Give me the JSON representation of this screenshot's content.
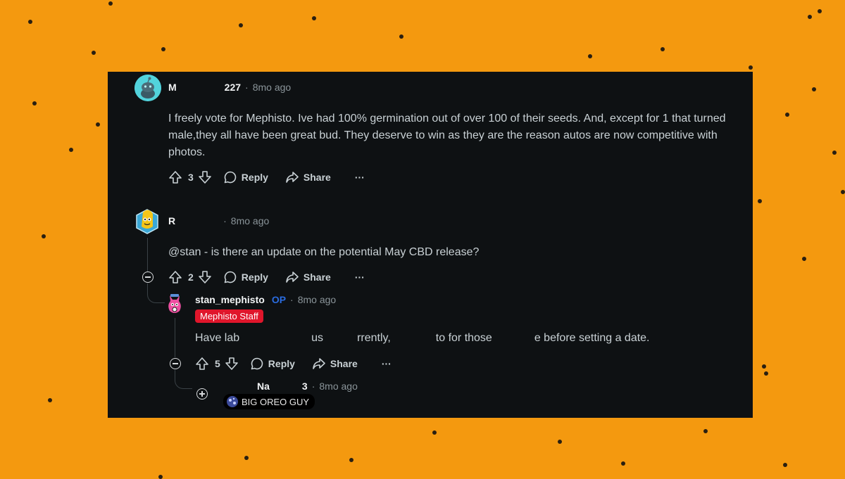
{
  "comments": [
    {
      "author": "M",
      "author_suffix": "227",
      "time": "8mo ago",
      "body": "I freely vote for Mephisto. Ive had 100% germination out of over 100 of their seeds. And, except for 1 that turned male,they all have been great bud. They deserve to win as they are the reason autos are now competitive with photos.",
      "votes": "3",
      "reply_label": "Reply",
      "share_label": "Share",
      "more_label": "···"
    },
    {
      "author": "R",
      "time": "8mo ago",
      "body": "@stan - is there an update on the potential May CBD release?",
      "votes": "2",
      "reply_label": "Reply",
      "share_label": "Share",
      "more_label": "···"
    },
    {
      "author": "stan_mephisto",
      "op_badge": "OP",
      "time": "8mo ago",
      "flair": "Mephisto Staff",
      "body_parts": [
        "Have lab",
        "us",
        "rrently,",
        "to for those",
        "e before setting a date."
      ],
      "votes": "5",
      "reply_label": "Reply",
      "share_label": "Share",
      "more_label": "···"
    },
    {
      "author": "Na",
      "author_suffix": "3",
      "time": "8mo ago",
      "flair": "BIG OREO GUY"
    }
  ],
  "colors": {
    "background": "#f4990f",
    "panel": "#0e1113",
    "staff_flair": "#e0162b",
    "op": "#2a6ce0"
  },
  "icons": [
    "snoo-avatar-icon",
    "banana-avatar-icon",
    "mephisto-avatar-icon",
    "upvote-icon",
    "downvote-icon",
    "comment-icon",
    "share-icon",
    "collapse-icon",
    "expand-icon",
    "oreo-flair-icon"
  ]
}
